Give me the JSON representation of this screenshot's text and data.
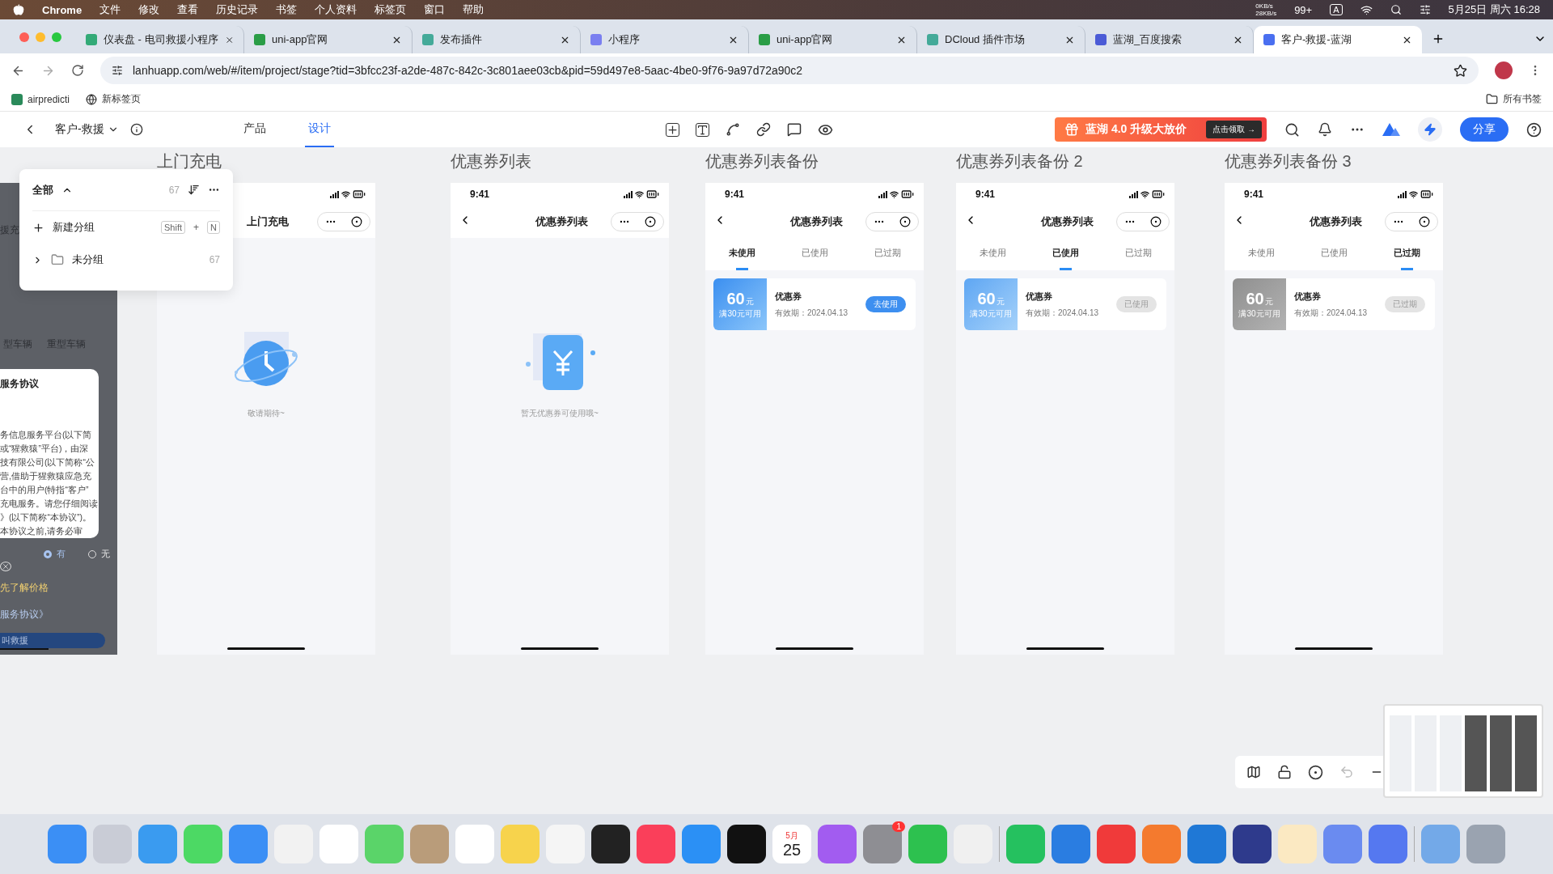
{
  "menubar": {
    "app": "Chrome",
    "items": [
      "文件",
      "修改",
      "查看",
      "历史记录",
      "书签",
      "个人资料",
      "标签页",
      "窗口",
      "帮助"
    ],
    "net_up": "0KB/s",
    "net_down": "28KB/s",
    "notifications": "99+",
    "input": "A",
    "datetime": "5月25日 周六  16:28"
  },
  "tabs": [
    {
      "title": "仪表盘 - 电司救援小程序",
      "selected": false
    },
    {
      "title": "uni-app官网",
      "selected": false
    },
    {
      "title": "发布插件",
      "selected": false
    },
    {
      "title": "小程序",
      "selected": false
    },
    {
      "title": "uni-app官网",
      "selected": false
    },
    {
      "title": "DCloud 插件市场",
      "selected": false
    },
    {
      "title": "蓝湖_百度搜索",
      "selected": false
    },
    {
      "title": "客户-救援-蓝湖",
      "selected": true
    }
  ],
  "address": "lanhuapp.com/web/#/item/project/stage?tid=3bfcc23f-a2de-487c-842c-3c801aee03cb&pid=59d497e8-5aac-4be0-9f76-9a97d72a90c2",
  "bookmarks": [
    "airpredicti",
    "新标签页"
  ],
  "all_bookmarks": "所有书签",
  "toolbar": {
    "project": "客户-救援",
    "tabs": [
      {
        "label": "产品",
        "selected": false
      },
      {
        "label": "设计",
        "selected": true
      }
    ],
    "promo": "蓝湖 4.0 升级大放价",
    "promo_button": "点击领取 →",
    "share": "分享"
  },
  "group_panel": {
    "title": "全部",
    "count": "67",
    "new_group": "新建分组",
    "shortcut": [
      "Shift",
      "+",
      "N"
    ],
    "groups": [
      {
        "name": "未分组",
        "count": "67",
        "expanded": false
      }
    ]
  },
  "partial_frame": {
    "top_label": "援充",
    "vehicles": [
      "型车辆",
      "重型车辆"
    ],
    "dialog_title": "服务协议",
    "dialog_lines": [
      "务信息服务平台(以下简",
      "或“猩救猿”平台)，由深",
      "技有限公司(以下简称“公",
      "营,借助于猩救猿应急充",
      "台中的用户(特指“客户”",
      "充电服务。请您仔细阅读",
      "》(以下简称“本协议”)。",
      "本协议之前,请务必审"
    ],
    "options": [
      {
        "label": "有",
        "selected": true
      },
      {
        "label": "无",
        "selected": false
      }
    ],
    "price_hint": "先了解价格",
    "agreement_link": "服务协议》",
    "call_button": "叫救援"
  },
  "frames": [
    {
      "title": "上门充电",
      "kind": "empty",
      "nav_title": "上门充电",
      "illustration": {
        "kind": "clock"
      },
      "empty_text": "敬请期待~"
    },
    {
      "title": "优惠券列表",
      "kind": "empty",
      "time": "9:41",
      "back": true,
      "nav_title": "优惠券列表",
      "illustration": {
        "kind": "ticket"
      },
      "empty_text": "暂无优惠券可使用哦~"
    },
    {
      "title": "优惠券列表备份",
      "kind": "coupons",
      "time": "9:41",
      "back": true,
      "nav_title": "优惠券列表",
      "tabs": [
        {
          "label": "未使用",
          "selected": true
        },
        {
          "label": "已使用",
          "selected": false
        },
        {
          "label": "已过期",
          "selected": false
        }
      ],
      "coupon": {
        "kind": "active",
        "amount": "60",
        "unit": "元",
        "condition": "满30元可用",
        "name": "优惠券",
        "validity": "有效期：2024.04.13",
        "action": "去使用"
      }
    },
    {
      "title": "优惠券列表备份 2",
      "kind": "coupons",
      "time": "9:41",
      "back": true,
      "nav_title": "优惠券列表",
      "tabs": [
        {
          "label": "未使用",
          "selected": false
        },
        {
          "label": "已使用",
          "selected": true
        },
        {
          "label": "已过期",
          "selected": false
        }
      ],
      "coupon": {
        "kind": "used",
        "amount": "60",
        "unit": "元",
        "condition": "满30元可用",
        "name": "优惠券",
        "validity": "有效期：2024.04.13",
        "action": "已使用"
      }
    },
    {
      "title": "优惠券列表备份 3",
      "kind": "coupons",
      "time": "9:41",
      "back": true,
      "nav_title": "优惠券列表",
      "tabs": [
        {
          "label": "未使用",
          "selected": false
        },
        {
          "label": "已使用",
          "selected": false
        },
        {
          "label": "已过期",
          "selected": true
        }
      ],
      "coupon": {
        "kind": "expired",
        "amount": "60",
        "unit": "元",
        "condition": "满30元可用",
        "name": "优惠券",
        "validity": "有效期：2024.04.13",
        "action": "已过期"
      }
    }
  ],
  "dock": {
    "calendar_month": "5月",
    "calendar_day": "25",
    "settings_badge": "1"
  }
}
